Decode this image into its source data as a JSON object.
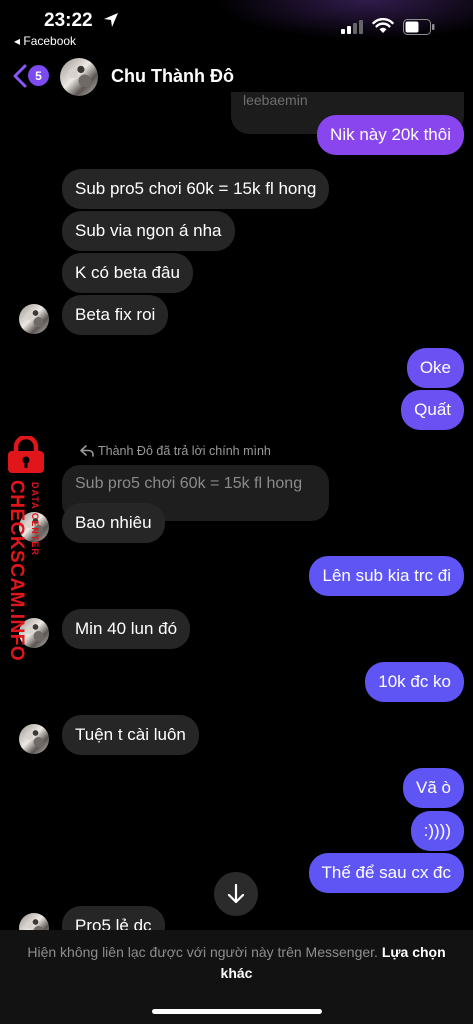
{
  "status_bar": {
    "time": "23:22",
    "back_app": "◂ Facebook"
  },
  "header": {
    "unread_count": "5",
    "contact_name": "Chu Thành Đô"
  },
  "conversation": {
    "previous_partial": "leebaemin",
    "msg_1": "Nik này 20k thôi",
    "msg_2": "Sub pro5 chơi 60k = 15k fl hong",
    "msg_3": "Sub via ngon á nha",
    "msg_4": "K có beta đâu",
    "msg_5": "Beta fix roi",
    "msg_6": "Oke",
    "msg_7": "Quất",
    "reply_note": "Thành Đô đã trả lời chính mình",
    "reply_quote": "Sub pro5 chơi 60k = 15k fl hong",
    "msg_8": "Bao nhiêu",
    "msg_9": "Lên sub kia trc đi",
    "msg_10": "Min 40 lun đó",
    "msg_11": "10k đc ko",
    "msg_12": "Tuện t cài luôn",
    "msg_13": "Vã ò",
    "msg_14": ":))))",
    "msg_15": "Thế để sau cx đc",
    "msg_16_partial": "Pro5 lẻ dc"
  },
  "footer": {
    "notice_text": "Hiện không liên lạc được với người này trên Messenger.",
    "notice_link": "Lựa chọn khác"
  },
  "watermark": {
    "main": "CHECKSCAM.INFO",
    "sub": "DATA CENTER"
  },
  "colors": {
    "incoming_bubble": "#262626",
    "outgoing_bubble": "#5f55f5",
    "accent": "#7b4bf0",
    "watermark": "#e0161b"
  },
  "icons": {
    "location": "location-arrow-icon",
    "back": "chevron-left-icon",
    "reply": "reply-arrow-icon",
    "scroll": "arrow-down-icon"
  }
}
